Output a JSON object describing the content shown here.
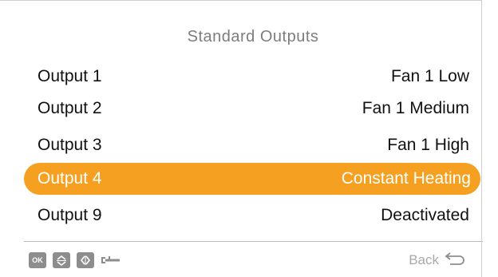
{
  "screen": {
    "title": "Standard Outputs",
    "items": [
      {
        "label": "Output 1",
        "value": "Fan 1 Low"
      },
      {
        "label": "Output 2",
        "value": "Fan 1 Medium"
      },
      {
        "label": "Output 3",
        "value": "Fan 1 High"
      },
      {
        "label": "Output 4",
        "value": "Constant Heating"
      },
      {
        "label": "Output 9",
        "value": "Deactivated"
      }
    ]
  },
  "footer": {
    "ok_label": "OK",
    "back_label": "Back",
    "icons": [
      "ok-button-icon",
      "up-down-arrows-icon",
      "left-right-arrows-icon",
      "wrench-icon",
      "back-arrow-icon"
    ]
  },
  "colors": {
    "highlight": "#f5a020",
    "title": "#7d7d7d",
    "icon": "#8d8d8d"
  }
}
